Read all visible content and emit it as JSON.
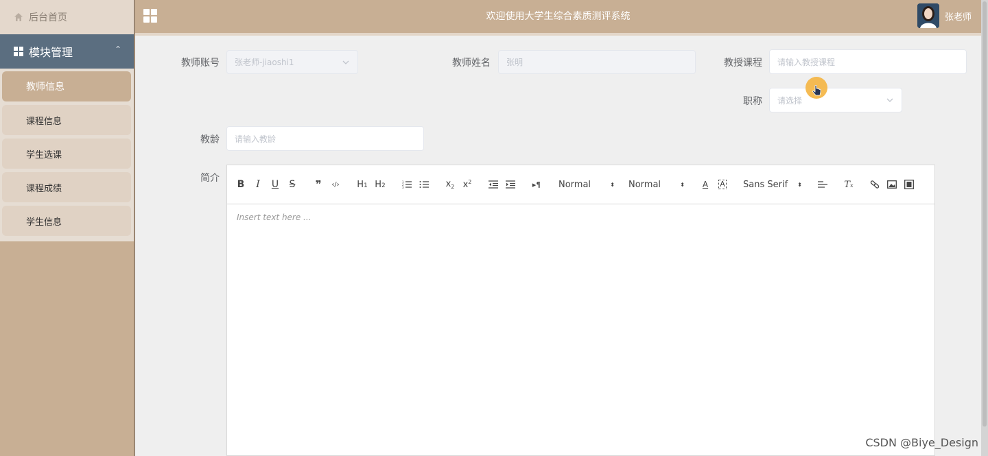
{
  "sidebar": {
    "home_label": "后台首页",
    "module_label": "模块管理",
    "items": [
      {
        "label": "教师信息",
        "active": true
      },
      {
        "label": "课程信息",
        "active": false
      },
      {
        "label": "学生选课",
        "active": false
      },
      {
        "label": "课程成绩",
        "active": false
      },
      {
        "label": "学生信息",
        "active": false
      }
    ]
  },
  "header": {
    "title": "欢迎使用大学生综合素质测评系统",
    "username": "张老师"
  },
  "form": {
    "account_label": "教师账号",
    "account_value": "张老师-jiaoshi1",
    "name_label": "教师姓名",
    "name_value": "张明",
    "course_label": "教授课程",
    "course_placeholder": "请输入教授课程",
    "title_label": "职称",
    "title_placeholder": "请选择",
    "age_label": "教龄",
    "age_placeholder": "请输入教龄",
    "intro_label": "简介"
  },
  "editor": {
    "header_picker": "Normal",
    "size_picker": "Normal",
    "font_picker": "Sans Serif",
    "placeholder": "Insert text here ..."
  },
  "watermark": "CSDN @Biye_Design",
  "colors": {
    "sidebar_bg": "#c8af94",
    "module_bg": "#5b6e80",
    "cursor": "#f5b84a"
  }
}
